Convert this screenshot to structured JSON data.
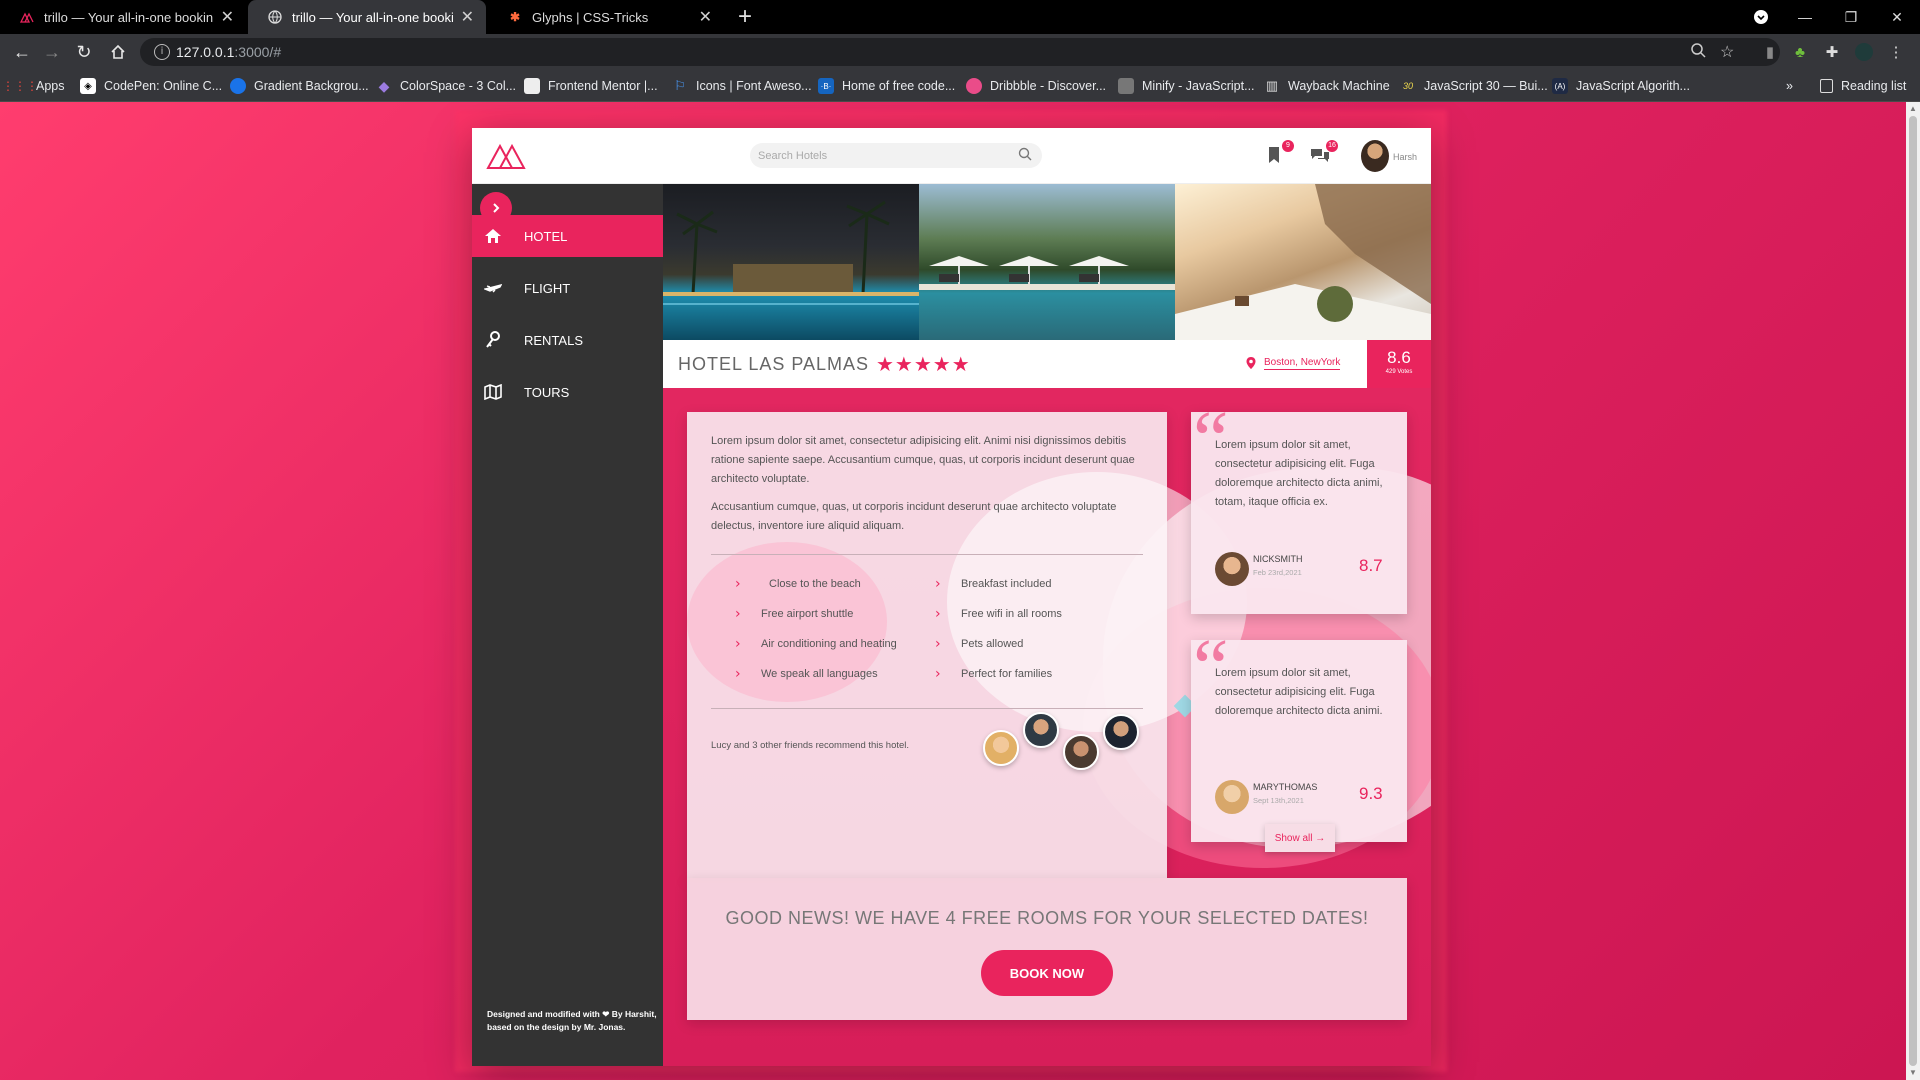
{
  "browser": {
    "tabs": [
      {
        "title": "trillo — Your all-in-one booking",
        "icon": "trillo-logo-icon",
        "active": false
      },
      {
        "title": "trillo — Your all-in-one booking",
        "icon": "globe-icon",
        "active": true
      },
      {
        "title": "Glyphs | CSS-Tricks",
        "icon": "css-tricks-icon",
        "active": false
      }
    ],
    "url_host": "127.0.0.1",
    "url_path": ":3000/#",
    "bookmarks": [
      {
        "label": "Apps",
        "icon": "apps-grid-icon",
        "color": "#e8453c"
      },
      {
        "label": "CodePen: Online C...",
        "icon": "codepen-icon",
        "color": "#444"
      },
      {
        "label": "Gradient Backgrou...",
        "icon": "gradient-icon",
        "color": "#1a73e8"
      },
      {
        "label": "ColorSpace - 3 Col...",
        "icon": "colorspace-icon",
        "color": "#7b5cd6"
      },
      {
        "label": "Frontend Mentor |...",
        "icon": "frontend-mentor-icon",
        "color": "#eeeeee"
      },
      {
        "label": "Icons | Font Aweso...",
        "icon": "font-awesome-icon",
        "color": "#1c7ed6"
      },
      {
        "label": "Home of free code...",
        "icon": "freecodecamp-icon",
        "color": "#1565c0"
      },
      {
        "label": "Dribbble - Discover...",
        "icon": "dribbble-icon",
        "color": "#ea4c89"
      },
      {
        "label": "Minify - JavaScript...",
        "icon": "minify-icon",
        "color": "#888"
      },
      {
        "label": "Wayback Machine",
        "icon": "wayback-icon",
        "color": "#555"
      },
      {
        "label": "JavaScript 30 — Bui...",
        "icon": "javascript30-icon",
        "color": "#f0db4f"
      },
      {
        "label": "JavaScript Algorith...",
        "icon": "js-algorithms-icon",
        "color": "#1f2a44"
      }
    ],
    "reading_list": "Reading list"
  },
  "app": {
    "search_placeholder": "Search Hotels",
    "bookmark_count": "9",
    "chat_count": "16",
    "user_name": "Harsh",
    "sidebar": [
      {
        "label": "HOTEL",
        "icon": "home-icon",
        "active": true
      },
      {
        "label": "FLIGHT",
        "icon": "plane-icon",
        "active": false
      },
      {
        "label": "RENTALS",
        "icon": "key-icon",
        "active": false
      },
      {
        "label": "TOURS",
        "icon": "map-icon",
        "active": false
      }
    ],
    "credit": "Designed and modified with ❤ By Harshit, based on the design by Mr. Jonas.",
    "hotel": {
      "name": "HOTEL LAS PALMAS",
      "stars": "★★★★★",
      "star_count": 5,
      "location": "Boston, NewYork",
      "rating": "8.6",
      "votes": "429 Votes"
    },
    "description": [
      "Lorem ipsum dolor sit amet, consectetur adipisicing elit. Animi nisi dignissimos debitis ratione sapiente saepe. Accusantium cumque, quas, ut corporis incidunt deserunt quae architecto voluptate.",
      "Accusantium cumque, quas, ut corporis incidunt deserunt quae architecto voluptate delectus, inventore iure aliquid aliquam."
    ],
    "features_left": [
      "Close to the beach",
      "Free airport shuttle",
      "Air conditioning and heating",
      "We speak all languages"
    ],
    "features_right": [
      "Breakfast included",
      "Free wifi in all rooms",
      "Pets allowed",
      "Perfect for families"
    ],
    "recommend": "Lucy and 3 other friends recommend this hotel.",
    "reviews": [
      {
        "text": "Lorem ipsum dolor sit amet, consectetur adipisicing elit. Fuga doloremque architecto dicta animi, totam, itaque officia ex.",
        "name": "NICKSMITH",
        "date": "Feb 23rd,2021",
        "score": "8.7"
      },
      {
        "text": "Lorem ipsum dolor sit amet, consectetur adipisicing elit. Fuga doloremque architecto dicta animi.",
        "name": "MARYTHOMAS",
        "date": "Sept 13th,2021",
        "score": "9.3"
      }
    ],
    "show_all": "Show all →",
    "cta_text": "GOOD NEWS! WE HAVE 4 FREE ROOMS FOR YOUR SELECTED DATES!",
    "book_now": "BOOK NOW",
    "accent": "#e9245d"
  }
}
